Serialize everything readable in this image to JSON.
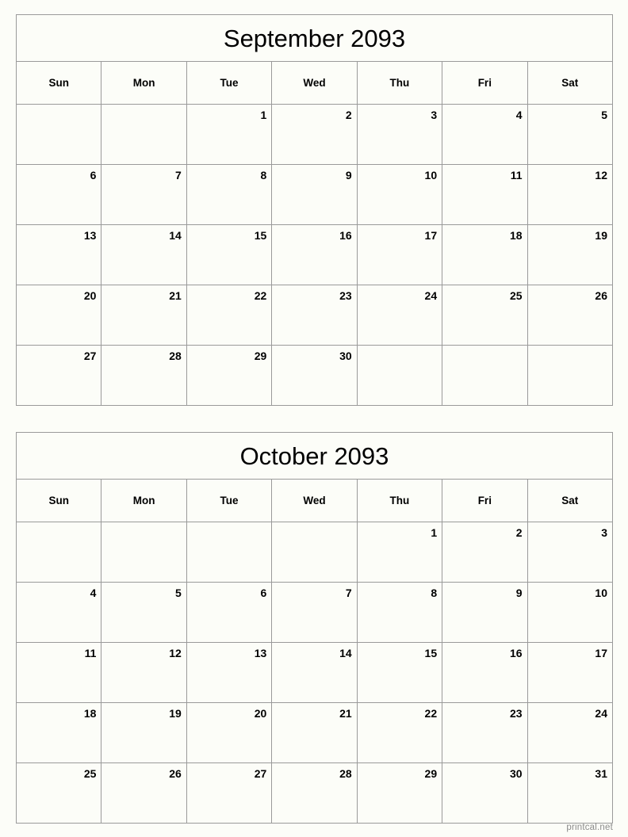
{
  "page": {
    "background_color": "#fcfdf8",
    "border_color": "#9a9a9a",
    "text_color": "#000000"
  },
  "footer": {
    "label": "printcal.net",
    "color": "#8b8b8b"
  },
  "weekdays": [
    "Sun",
    "Mon",
    "Tue",
    "Wed",
    "Thu",
    "Fri",
    "Sat"
  ],
  "calendars": [
    {
      "id": "september-2093",
      "title": "September 2093",
      "month_name": "September",
      "year": "2093",
      "first_weekday_index": 2,
      "days_in_month": 30,
      "weeks": [
        [
          "",
          "",
          "1",
          "2",
          "3",
          "4",
          "5"
        ],
        [
          "6",
          "7",
          "8",
          "9",
          "10",
          "11",
          "12"
        ],
        [
          "13",
          "14",
          "15",
          "16",
          "17",
          "18",
          "19"
        ],
        [
          "20",
          "21",
          "22",
          "23",
          "24",
          "25",
          "26"
        ],
        [
          "27",
          "28",
          "29",
          "30",
          "",
          "",
          ""
        ]
      ]
    },
    {
      "id": "october-2093",
      "title": "October 2093",
      "month_name": "October",
      "year": "2093",
      "first_weekday_index": 4,
      "days_in_month": 31,
      "weeks": [
        [
          "",
          "",
          "",
          "",
          "1",
          "2",
          "3"
        ],
        [
          "4",
          "5",
          "6",
          "7",
          "8",
          "9",
          "10"
        ],
        [
          "11",
          "12",
          "13",
          "14",
          "15",
          "16",
          "17"
        ],
        [
          "18",
          "19",
          "20",
          "21",
          "22",
          "23",
          "24"
        ],
        [
          "25",
          "26",
          "27",
          "28",
          "29",
          "30",
          "31"
        ]
      ]
    }
  ]
}
